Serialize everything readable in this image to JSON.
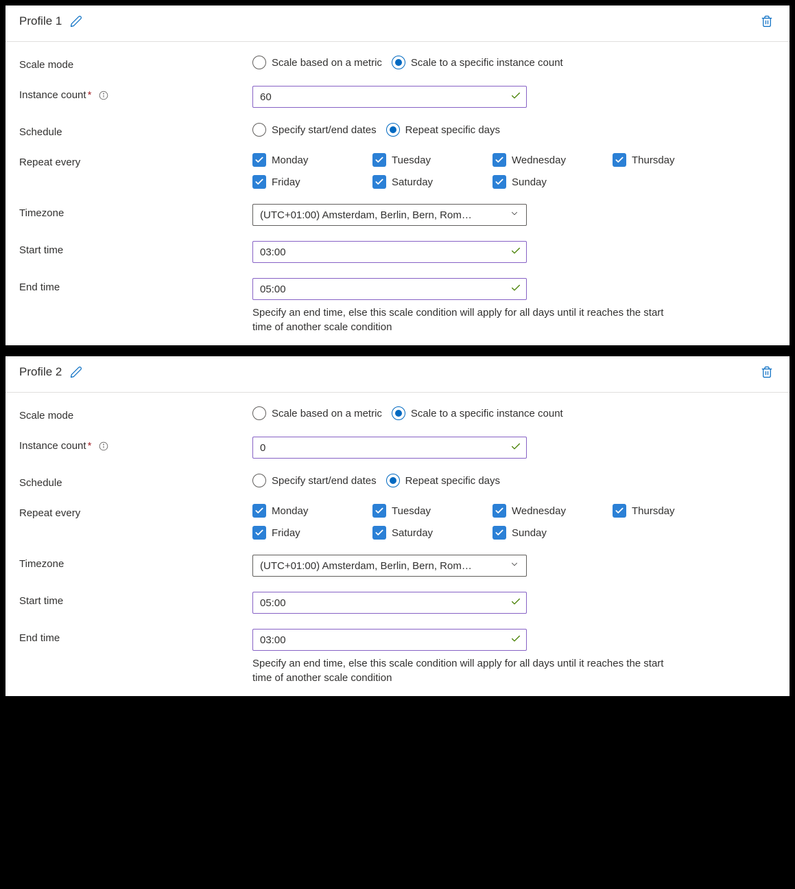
{
  "labels": {
    "scale_mode": "Scale mode",
    "instance_count": "Instance count",
    "schedule": "Schedule",
    "repeat_every": "Repeat every",
    "timezone": "Timezone",
    "start_time": "Start time",
    "end_time": "End time"
  },
  "radio": {
    "scale_metric": "Scale based on a metric",
    "scale_fixed": "Scale to a specific instance count",
    "specify_dates": "Specify start/end dates",
    "repeat_days": "Repeat specific days"
  },
  "days": {
    "mon": "Monday",
    "tue": "Tuesday",
    "wed": "Wednesday",
    "thu": "Thursday",
    "fri": "Friday",
    "sat": "Saturday",
    "sun": "Sunday"
  },
  "help": {
    "end_time": "Specify an end time, else this scale condition will apply for all days until it reaches the start time of another scale condition"
  },
  "timezone_value": "(UTC+01:00) Amsterdam, Berlin, Bern, Rom…",
  "profiles": [
    {
      "title": "Profile 1",
      "instance_count": "60",
      "start_time": "03:00",
      "end_time": "05:00"
    },
    {
      "title": "Profile 2",
      "instance_count": "0",
      "start_time": "05:00",
      "end_time": "03:00"
    }
  ]
}
